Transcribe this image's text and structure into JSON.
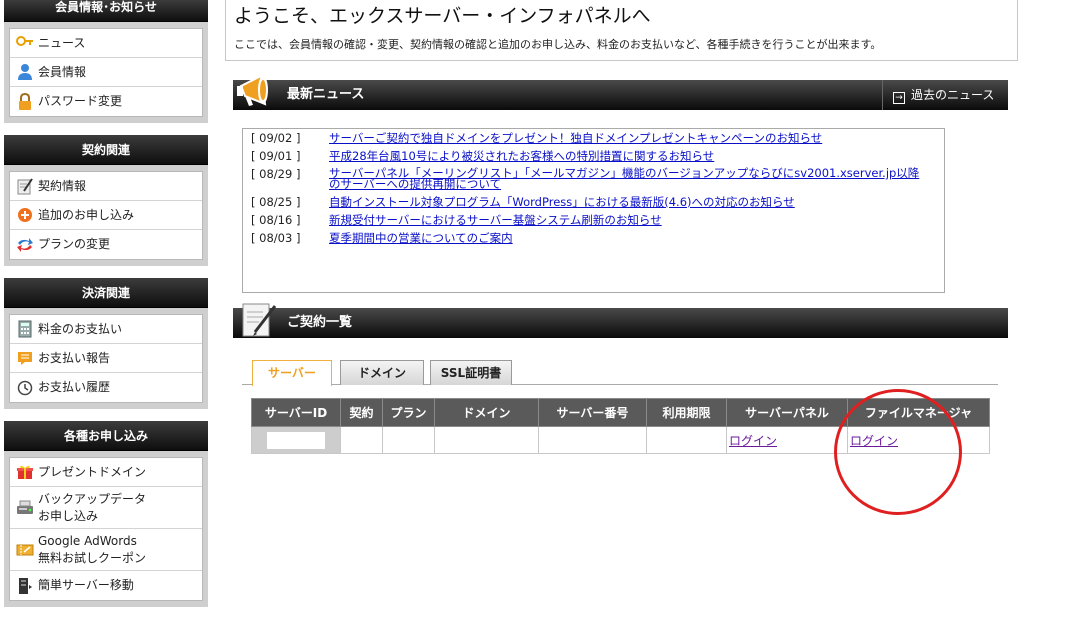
{
  "sidebar": {
    "sections": [
      {
        "title": "会員情報･お知らせ",
        "items": [
          {
            "label": "ニュース",
            "icon": "news-key-icon"
          },
          {
            "label": "会員情報",
            "icon": "user-icon"
          },
          {
            "label": "パスワード変更",
            "icon": "lock-icon"
          }
        ]
      },
      {
        "title": "契約関連",
        "items": [
          {
            "label": "契約情報",
            "icon": "contract-pen-icon"
          },
          {
            "label": "追加のお申し込み",
            "icon": "add-circle-icon"
          },
          {
            "label": "プランの変更",
            "icon": "swap-arrows-icon"
          }
        ]
      },
      {
        "title": "決済関連",
        "items": [
          {
            "label": "料金のお支払い",
            "icon": "calculator-icon"
          },
          {
            "label": "お支払い報告",
            "icon": "report-icon"
          },
          {
            "label": "お支払い履歴",
            "icon": "clock-icon"
          }
        ]
      },
      {
        "title": "各種お申し込み",
        "items": [
          {
            "label": "プレゼントドメイン",
            "icon": "gift-icon"
          },
          {
            "label_line1": "バックアップデータ",
            "label_line2": "お申し込み",
            "icon": "backup-drive-icon"
          },
          {
            "label_line1": "Google AdWords",
            "label_line2": "無料お試しクーポン",
            "icon": "coupon-icon"
          },
          {
            "label": "簡単サーバー移動",
            "icon": "server-move-icon"
          }
        ]
      }
    ]
  },
  "welcome": {
    "title": "ようこそ、エックスサーバー・インフォパネルへ",
    "description": "ここでは、会員情報の確認・変更、契約情報の確認と追加のお申し込み、料金のお支払いなど、各種手続きを行うことが出来ます。"
  },
  "news": {
    "title": "最新ニュース",
    "past_label": "過去のニュース",
    "items": [
      {
        "date": "[ 09/02 ]",
        "text": "サーバーご契約で独自ドメインをプレゼント！独自ドメインプレゼントキャンペーンのお知らせ"
      },
      {
        "date": "[ 09/01 ]",
        "text": "平成28年台風10号により被災されたお客様への特別措置に関するお知らせ"
      },
      {
        "date": "[ 08/29 ]",
        "text": "サーバーパネル「メーリングリスト」「メールマガジン」機能のバージョンアップならびにsv2001.xserver.jp以降のサーバーへの提供再開について"
      },
      {
        "date": "[ 08/25 ]",
        "text": "自動インストール対象プログラム「WordPress」における最新版(4.6)への対応のお知らせ"
      },
      {
        "date": "[ 08/16 ]",
        "text": "新規受付サーバーにおけるサーバー基盤システム刷新のお知らせ"
      },
      {
        "date": "[ 08/03 ]",
        "text": "夏季期間中の営業についてのご案内"
      }
    ]
  },
  "contracts": {
    "title": "ご契約一覧",
    "tabs": [
      {
        "label": "サーバー",
        "active": true
      },
      {
        "label": "ドメイン",
        "active": false
      },
      {
        "label": "SSL証明書",
        "active": false
      }
    ],
    "columns": [
      "サーバーID",
      "契約",
      "プラン",
      "ドメイン",
      "サーバー番号",
      "利用期限",
      "サーバーパネル",
      "ファイルマネージャ"
    ],
    "row": {
      "server_panel_login": "ログイン",
      "file_manager_login": "ログイン"
    }
  },
  "colors": {
    "bar_dark": "#0a0a0a",
    "link_blue": "#0a10c8",
    "link_visited": "#6a1a9a",
    "tab_active": "#f0a020",
    "highlight_circle": "#e02020"
  }
}
